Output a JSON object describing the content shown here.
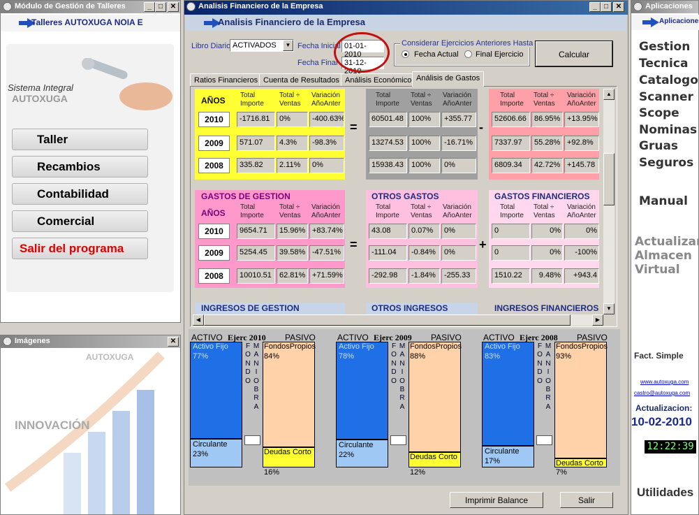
{
  "left_window": {
    "title": "Módulo de Gestión de Talleres",
    "header": "Talleres AUTOXUGA NOIA E",
    "logo_line1": "Sistema Integral",
    "logo_line2": "AUTOXUGA",
    "buttons": [
      "Taller",
      "Recambios",
      "Contabilidad",
      "Comercial",
      "Salir del programa"
    ]
  },
  "images_window": {
    "title": "Imágenes",
    "brand": "AUTOXUGA",
    "caption": "INNOVACIÓN"
  },
  "main_window": {
    "title": "Analisis Financiero de la Empresa",
    "header": "Analisis Financiero de la Empresa",
    "libro_label": "Libro Diario",
    "libro_value": "ACTIVADOS",
    "fecha_inicial_label": "Fecha Inicial",
    "fecha_inicial": "01-01-2010",
    "fecha_final_label": "Fecha Final",
    "fecha_final": "31-12-2010",
    "group_label": "Considerar Ejercicios Anteriores Hasta",
    "radio1": "Fecha Actual",
    "radio2": "Final Ejercicio",
    "calc_button": "Calcular",
    "tabs": [
      "Ratios Financieros",
      "Cuenta de Resultados",
      "Análisis Económico",
      "Análisis de Gastos"
    ],
    "col_total_a": "Total",
    "col_total_b": "Importe",
    "col_ratio_a": "Total ÷",
    "col_ratio_b": "Ventas",
    "col_var_a": "Variación",
    "col_var_b": "AñoAnter",
    "anos_label": "AÑOS",
    "years": [
      "2010",
      "2009",
      "2008"
    ],
    "eq": "=",
    "minus": "-",
    "plus": "+",
    "block1_left": [
      [
        "-1716.81",
        "0%",
        "-400.63%"
      ],
      [
        "571.07",
        "4.3%",
        "-98.3%"
      ],
      [
        "335.82",
        "2.11%",
        "0%"
      ]
    ],
    "block1_mid": [
      [
        "60501.48",
        "100%",
        "+355.77"
      ],
      [
        "13274.53",
        "100%",
        "-16.71%"
      ],
      [
        "15938.43",
        "100%",
        "0%"
      ]
    ],
    "block1_right": [
      [
        "52606.66",
        "86.95%",
        "+13.95%"
      ],
      [
        "7337.97",
        "55.28%",
        "+92.8%"
      ],
      [
        "6809.34",
        "42.72%",
        "+145.78"
      ]
    ],
    "gastos_gestion_title": "GASTOS DE GESTION",
    "otros_gastos_title": "OTROS GASTOS",
    "gastos_fin_title": "GASTOS FINANCIEROS",
    "block2_left": [
      [
        "9654.71",
        "15.96%",
        "+83.74%"
      ],
      [
        "5254.45",
        "39.58%",
        "-47.51%"
      ],
      [
        "10010.51",
        "62.81%",
        "+71.59%"
      ]
    ],
    "block2_mid": [
      [
        "43.08",
        "0.07%",
        "0%"
      ],
      [
        "-111.04",
        "-0.84%",
        "0%"
      ],
      [
        "-292.98",
        "-1.84%",
        "-255.33"
      ]
    ],
    "block2_right": [
      [
        "0",
        "0%",
        "0%"
      ],
      [
        "0",
        "0%",
        "-100%"
      ],
      [
        "1510.22",
        "9.48%",
        "+943.4"
      ]
    ],
    "ingresos_gestion": "INGRESOS DE GESTION",
    "otros_ingresos": "OTROS INGRESOS",
    "ingresos_fin": "INGRESOS FINANCIEROS",
    "balances": [
      {
        "activo": "ACTIVO",
        "ejerc": "Ejerc 2010",
        "pasivo": "PASIVO",
        "activo_fijo": "Activo Fijo",
        "af_pct": "77%",
        "circulante": "Circulante",
        "c_pct": "23%",
        "fondos": "FondosPropios",
        "f_pct": "84%",
        "deudas": "Deudas Corto",
        "d_pct": "16%"
      },
      {
        "activo": "ACTIVO",
        "ejerc": "Ejerc 2009",
        "pasivo": "PASIVO",
        "activo_fijo": "Activo Fijo",
        "af_pct": "78%",
        "circulante": "Circulante",
        "c_pct": "22%",
        "fondos": "FondosPropios",
        "f_pct": "88%",
        "deudas": "Deudas Corto",
        "d_pct": "12%"
      },
      {
        "activo": "ACTIVO",
        "ejerc": "Ejerc 2008",
        "pasivo": "PASIVO",
        "activo_fijo": "Activo Fijo",
        "af_pct": "83%",
        "circulante": "Circulante",
        "c_pct": "17%",
        "fondos": "FondosPropios",
        "f_pct": "93%",
        "deudas": "Deudas Corto",
        "d_pct": "7%"
      }
    ],
    "fondo_maniobra": "FONDO",
    "maniobra": "MANIOBRA",
    "print_button": "Imprimir Balance",
    "exit_button": "Salir"
  },
  "right_window": {
    "title": "Aplicaciones",
    "header": "Aplicaciones",
    "menu": [
      "Gestion",
      "Tecnica",
      "Catalogos",
      "Scanner",
      "Scope",
      "Nominas",
      "Gruas",
      "Seguros"
    ],
    "manual": "Manual",
    "actualizar": [
      "Actualizar",
      "Almacen",
      "Virtual"
    ],
    "fact": "Fact. Simple",
    "web": "www.autoxuga.com",
    "email": "castro@autoxuga.com",
    "act_label": "Actualizacion:",
    "act_date": "10-02-2010",
    "clock": "12:22:39",
    "utilidades": "Utilidades"
  },
  "colors": {
    "yellow": "#ffff33",
    "grey": "#a0a0a0",
    "salmon": "#ffa0a8",
    "pink_dark": "#ff99cc",
    "pink_light": "#ffc0e0",
    "pink_pale": "#ffd8ee",
    "blue": "#1f6fe6",
    "peach": "#ffd2aa"
  }
}
